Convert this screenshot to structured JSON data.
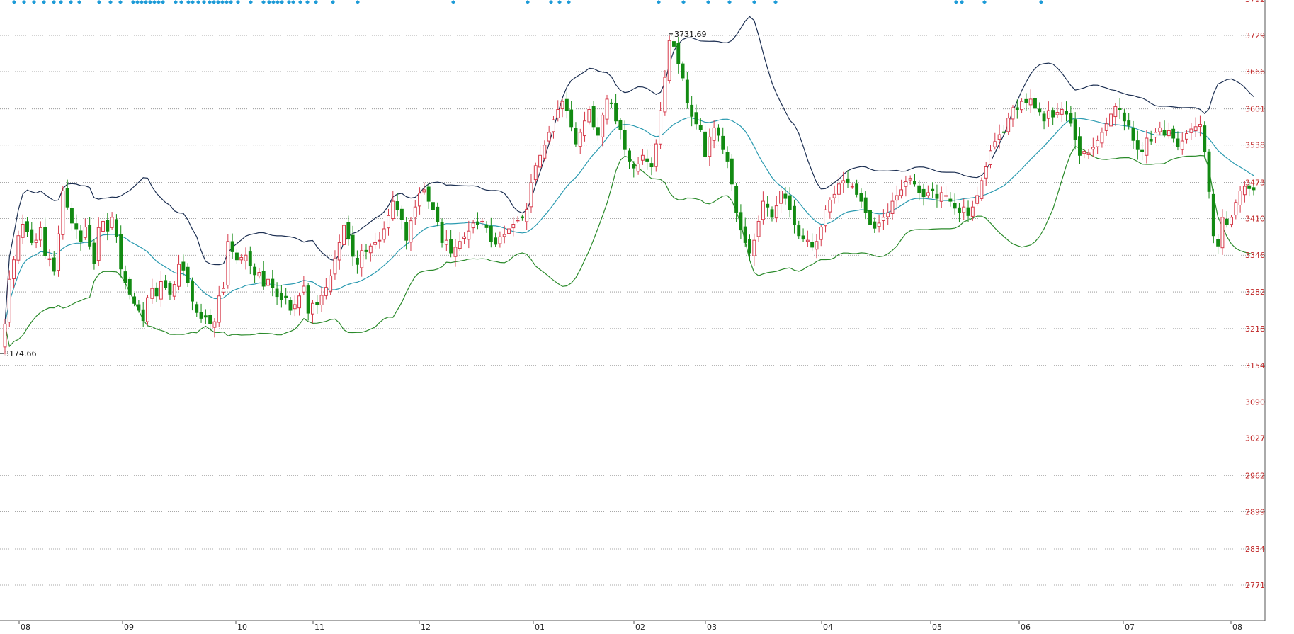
{
  "chart_data": {
    "type": "candlestick",
    "title": "",
    "xlabel": "",
    "ylabel": "",
    "ylim": [
      2700,
      3792
    ],
    "y_ticks": [
      "3792",
      "3729",
      "3666",
      "3601",
      "3538",
      "3473",
      "3410",
      "3346",
      "3282",
      "3218",
      "3154",
      "3090",
      "3027",
      "2962",
      "2899",
      "2834",
      "2771"
    ],
    "x_ticks": [
      "08",
      "09",
      "10",
      "11",
      "12",
      "01",
      "02",
      "03",
      "04",
      "05",
      "06",
      "07",
      "08"
    ],
    "max_label": "3731.69",
    "min_label": "3174.66",
    "grid": true,
    "colors": {
      "up": "#d63a4a",
      "down": "#128a12",
      "upper_band": "#1c2f52",
      "middle_band": "#2a9ab0",
      "lower_band": "#2a8a2a",
      "signal": "#1e9bd7",
      "axis_text": "#c02828",
      "grid": "#8a8a8a"
    },
    "closes": [
      3226,
      3304,
      3338,
      3380,
      3400,
      3387,
      3368,
      3372,
      3394,
      3345,
      3340,
      3318,
      3383,
      3458,
      3430,
      3402,
      3392,
      3370,
      3395,
      3362,
      3332,
      3394,
      3405,
      3388,
      3412,
      3378,
      3322,
      3298,
      3278,
      3262,
      3250,
      3232,
      3272,
      3288,
      3275,
      3300,
      3290,
      3278,
      3295,
      3330,
      3320,
      3298,
      3266,
      3246,
      3236,
      3238,
      3226,
      3230,
      3275,
      3288,
      3370,
      3352,
      3338,
      3342,
      3346,
      3328,
      3312,
      3316,
      3292,
      3304,
      3290,
      3274,
      3268,
      3272,
      3250,
      3260,
      3275,
      3292,
      3245,
      3262,
      3260,
      3276,
      3290,
      3310,
      3340,
      3368,
      3398,
      3374,
      3344,
      3330,
      3354,
      3352,
      3362,
      3368,
      3372,
      3392,
      3415,
      3440,
      3425,
      3408,
      3372,
      3406,
      3430,
      3454,
      3460,
      3440,
      3425,
      3404,
      3368,
      3372,
      3350,
      3360,
      3370,
      3378,
      3388,
      3402,
      3400,
      3405,
      3394,
      3370,
      3365,
      3378,
      3382,
      3392,
      3400,
      3407,
      3411,
      3426,
      3472,
      3502,
      3520,
      3538,
      3560,
      3582,
      3600,
      3614,
      3598,
      3570,
      3540,
      3560,
      3580,
      3600,
      3570,
      3555,
      3590,
      3618,
      3610,
      3580,
      3565,
      3530,
      3510,
      3498,
      3505,
      3520,
      3510,
      3500,
      3540,
      3598,
      3656,
      3720,
      3710,
      3680,
      3655,
      3612,
      3588,
      3575,
      3565,
      3518,
      3552,
      3568,
      3555,
      3530,
      3510,
      3470,
      3420,
      3390,
      3368,
      3350,
      3372,
      3405,
      3440,
      3430,
      3412,
      3432,
      3458,
      3445,
      3425,
      3400,
      3380,
      3374,
      3372,
      3360,
      3370,
      3395,
      3425,
      3442,
      3452,
      3470,
      3476,
      3472,
      3466,
      3452,
      3440,
      3420,
      3400,
      3393,
      3402,
      3412,
      3420,
      3440,
      3450,
      3460,
      3474,
      3480,
      3470,
      3455,
      3448,
      3455,
      3458,
      3445,
      3455,
      3450,
      3440,
      3428,
      3420,
      3430,
      3415,
      3430,
      3450,
      3476,
      3500,
      3528,
      3544,
      3556,
      3560,
      3585,
      3603,
      3600,
      3614,
      3612,
      3618,
      3602,
      3596,
      3580,
      3598,
      3587,
      3595,
      3600,
      3592,
      3576,
      3547,
      3520,
      3527,
      3524,
      3534,
      3546,
      3560,
      3575,
      3592,
      3605,
      3600,
      3580,
      3572,
      3546,
      3530,
      3527,
      3550,
      3545,
      3560,
      3568,
      3555,
      3563,
      3550,
      3535,
      3545,
      3558,
      3566,
      3570,
      3574,
      3527,
      3457,
      3380,
      3362,
      3412,
      3400,
      3412,
      3438,
      3458,
      3466,
      3462,
      3460
    ],
    "series": [
      {
        "name": "",
        "values": []
      }
    ]
  }
}
